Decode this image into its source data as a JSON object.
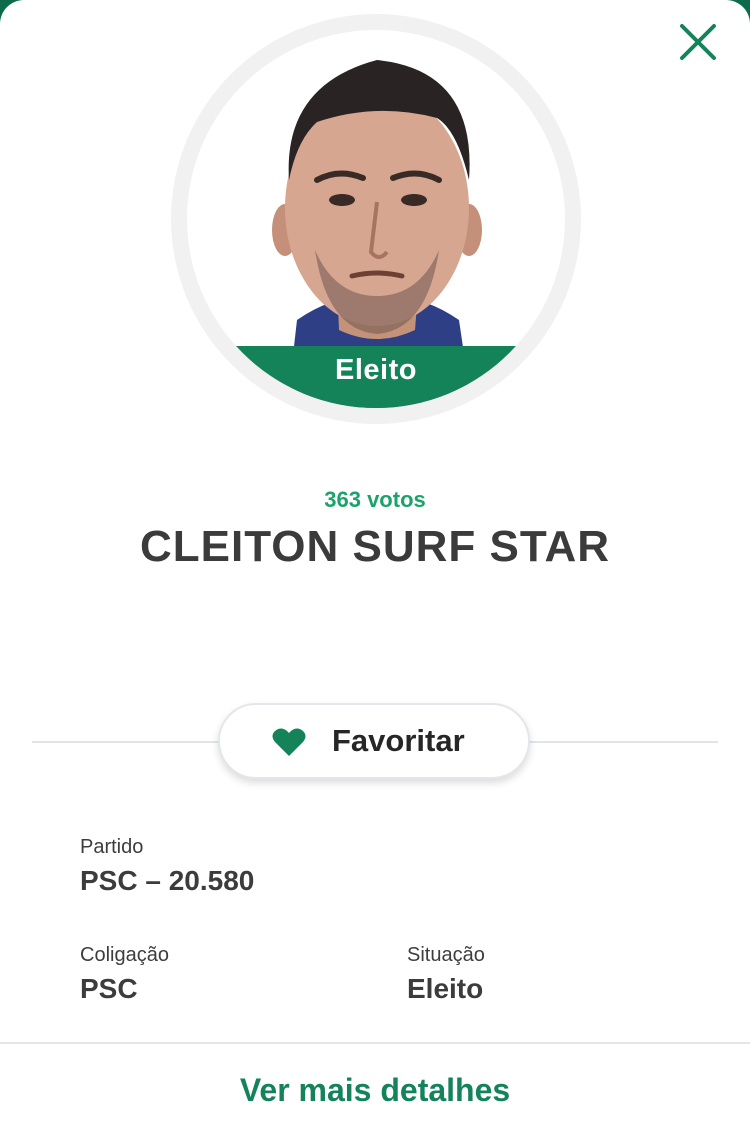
{
  "candidate": {
    "votes_text": "363 votos",
    "name": "CLEITON SURF STAR",
    "status_badge": "Eleito"
  },
  "actions": {
    "favorite_label": "Favoritar",
    "more_details_label": "Ver mais detalhes"
  },
  "fields": {
    "party": {
      "label": "Partido",
      "value": "PSC – 20.580"
    },
    "coalition": {
      "label": "Coligação",
      "value": "PSC"
    },
    "situation": {
      "label": "Situação",
      "value": "Eleito"
    }
  },
  "icons": {
    "close": "close-icon",
    "favorite": "heart-icon"
  },
  "colors": {
    "accent": "#14835a",
    "votes": "#1ca36c",
    "text_dark": "#3b3b3b"
  }
}
